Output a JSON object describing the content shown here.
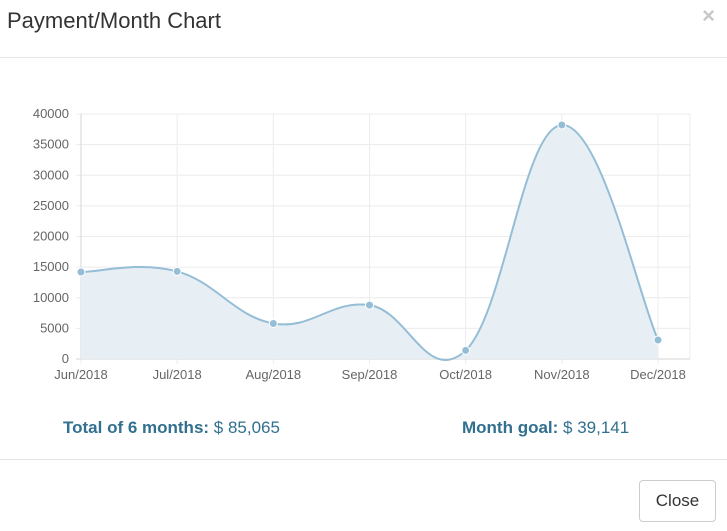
{
  "modal": {
    "title": "Payment/Month Chart",
    "close_icon": "×",
    "close_button_label": "Close"
  },
  "summary": {
    "total_label": "Total of 6 months:",
    "total_value": "$ 85,065",
    "goal_label": "Month goal:",
    "goal_value": "$ 39,141"
  },
  "colors": {
    "line": "#95bdd6",
    "fill": "#e7eff5",
    "point": "#95bdd6",
    "summary_text": "#31708f",
    "grid": "#ececec"
  },
  "chart_data": {
    "type": "area",
    "categories": [
      "Jun/2018",
      "Jul/2018",
      "Aug/2018",
      "Sep/2018",
      "Oct/2018",
      "Nov/2018",
      "Dec/2018"
    ],
    "series": [
      {
        "values": [
          14200,
          14300,
          5800,
          8800,
          1400,
          38200,
          3100
        ]
      }
    ],
    "ylim": [
      0,
      40000
    ],
    "yticks": [
      0,
      5000,
      10000,
      15000,
      20000,
      25000,
      30000,
      35000,
      40000
    ],
    "smooth": true,
    "grid": true,
    "legend": "none"
  }
}
